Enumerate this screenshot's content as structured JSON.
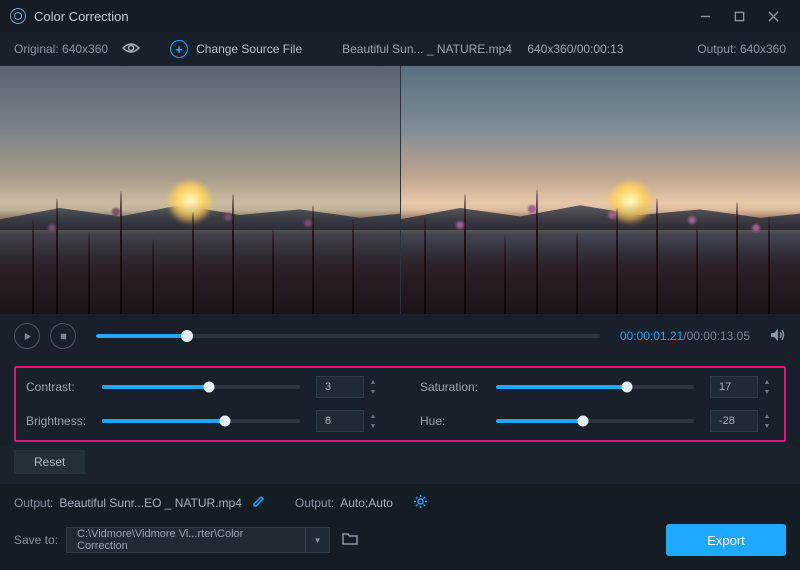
{
  "titlebar": {
    "title": "Color Correction"
  },
  "infobar": {
    "original_label": "Original: 640x360",
    "change_source": "Change Source File",
    "file_name": "Beautiful Sun... _ NATURE.mp4",
    "file_meta": "640x360/00:00:13",
    "output_label": "Output: 640x360"
  },
  "playback": {
    "progress_pct": 18,
    "time_current": "00:00:01.21",
    "time_total": "/00:00:13.05"
  },
  "adjust": {
    "contrast": {
      "label": "Contrast:",
      "value": "3",
      "pct": 54
    },
    "brightness": {
      "label": "Brightness:",
      "value": "8",
      "pct": 62
    },
    "saturation": {
      "label": "Saturation:",
      "value": "17",
      "pct": 66
    },
    "hue": {
      "label": "Hue:",
      "value": "-28",
      "pct": 44
    }
  },
  "buttons": {
    "reset": "Reset",
    "export": "Export"
  },
  "output": {
    "file_label": "Output:",
    "file_value": "Beautiful Sunr...EO _ NATUR.mp4",
    "settings_label": "Output:",
    "settings_value": "Auto;Auto",
    "save_label": "Save to:",
    "save_path": "C:\\Vidmore\\Vidmore Vi...rter\\Color Correction"
  }
}
